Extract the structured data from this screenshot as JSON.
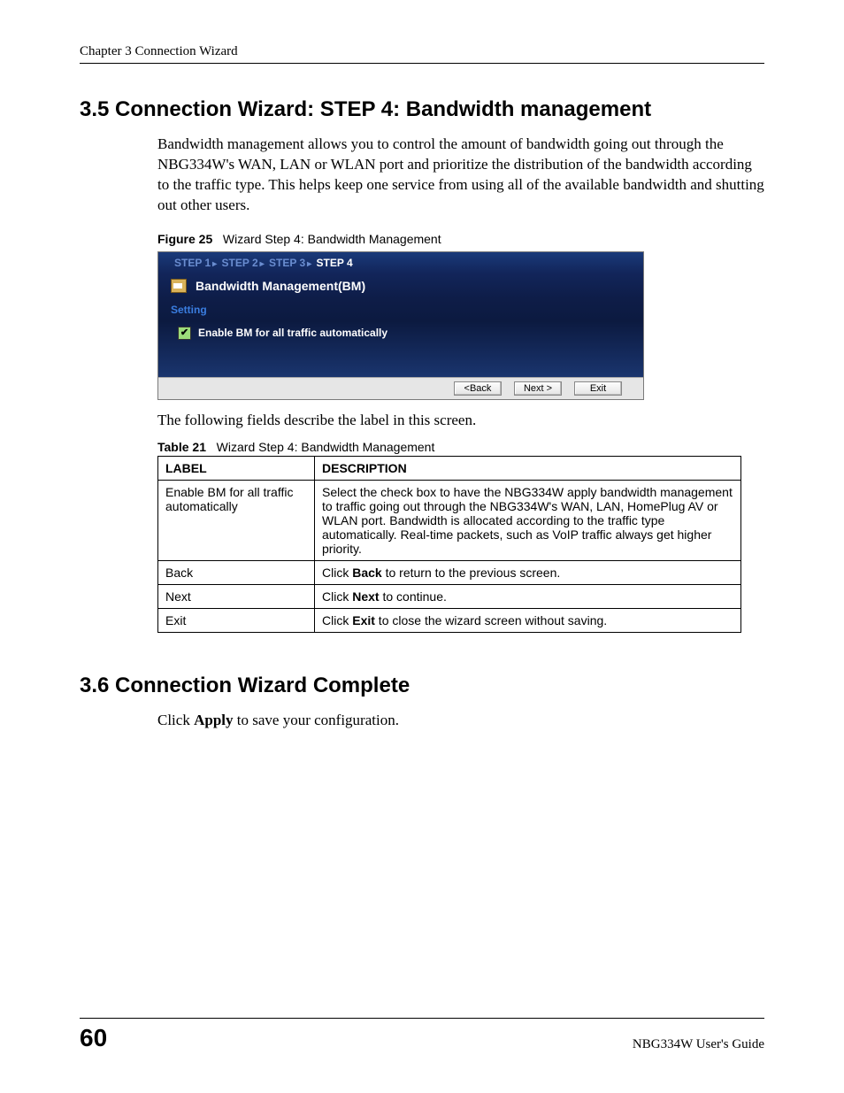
{
  "header": {
    "running_head": "Chapter 3 Connection Wizard"
  },
  "section_35": {
    "heading": "3.5  Connection Wizard: STEP 4: Bandwidth management",
    "para": "Bandwidth management allows you to control the amount of bandwidth going out through the NBG334W's WAN, LAN or WLAN port and prioritize the distribution of the bandwidth according to the traffic type. This helps keep one service from using all of the available bandwidth and shutting out other users.",
    "figure_label": "Figure 25",
    "figure_title": "Wizard Step 4: Bandwidth Management",
    "after_figure_para": "The following fields describe the label in this screen.",
    "table_label": "Table 21",
    "table_title": "Wizard Step 4: Bandwidth Management"
  },
  "wizard": {
    "steps": {
      "s1": "STEP 1",
      "s2": "STEP 2",
      "s3": "STEP 3",
      "s4": "STEP 4"
    },
    "title": "Bandwidth Management(BM)",
    "setting_head": "Setting",
    "checkbox_label": "Enable BM for all traffic automatically",
    "buttons": {
      "back": "<Back",
      "next": "Next >",
      "exit": "Exit"
    }
  },
  "desc_table": {
    "head_label": "LABEL",
    "head_desc": "DESCRIPTION",
    "rows": [
      {
        "label": "Enable BM for all traffic automatically",
        "desc": "Select the check box to have the NBG334W apply bandwidth management to traffic going out through the NBG334W's WAN, LAN, HomePlug AV or WLAN port. Bandwidth is allocated according to the traffic type automatically. Real-time packets, such as VoIP traffic always get higher priority."
      },
      {
        "label": "Back",
        "desc_prefix": "Click ",
        "desc_bold": "Back",
        "desc_suffix": " to return to the previous screen."
      },
      {
        "label": "Next",
        "desc_prefix": "Click ",
        "desc_bold": "Next",
        "desc_suffix": " to continue."
      },
      {
        "label": "Exit",
        "desc_prefix": "Click ",
        "desc_bold": "Exit",
        "desc_suffix": " to close the wizard screen without saving."
      }
    ]
  },
  "section_36": {
    "heading": "3.6  Connection Wizard Complete",
    "para_prefix": "Click ",
    "para_bold": "Apply",
    "para_suffix": " to save your configuration."
  },
  "footer": {
    "page_number": "60",
    "guide": "NBG334W User's Guide"
  }
}
